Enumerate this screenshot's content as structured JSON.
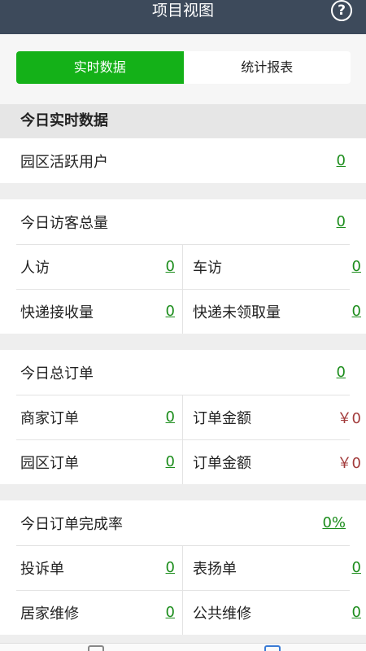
{
  "header": {
    "title": "项目视图",
    "help_icon": "help-circle-icon"
  },
  "tabs": [
    {
      "label": "实时数据",
      "active": true
    },
    {
      "label": "统计报表",
      "active": false
    }
  ],
  "section": {
    "title": "今日实时数据"
  },
  "park_active_users": {
    "label": "园区活跃用户",
    "value": "0"
  },
  "visitors": {
    "total": {
      "label": "今日访客总量",
      "value": "0"
    },
    "person": {
      "label": "人访",
      "value": "0"
    },
    "vehicle": {
      "label": "车访",
      "value": "0"
    },
    "express_received": {
      "label": "快递接收量",
      "value": "0"
    },
    "express_unclaimed": {
      "label": "快递未领取量",
      "value": "0"
    }
  },
  "orders": {
    "total": {
      "label": "今日总订单",
      "value": "0"
    },
    "merchant": {
      "label": "商家订单",
      "value": "0"
    },
    "merchant_amount": {
      "label": "订单金额",
      "value": "￥0"
    },
    "park": {
      "label": "园区订单",
      "value": "0"
    },
    "park_amount": {
      "label": "订单金额",
      "value": "￥0"
    }
  },
  "completion": {
    "rate": {
      "label": "今日订单完成率",
      "value": "0%"
    },
    "complaint": {
      "label": "投诉单",
      "value": "0"
    },
    "praise": {
      "label": "表扬单",
      "value": "0"
    },
    "home_repair": {
      "label": "居家维修",
      "value": "0"
    },
    "public_repair": {
      "label": "公共维修",
      "value": "0"
    }
  },
  "colors": {
    "header_bg": "#3d4a5b",
    "active_tab": "#14b118",
    "link_green": "#1c8d1c",
    "money_red": "#a23b3b"
  }
}
